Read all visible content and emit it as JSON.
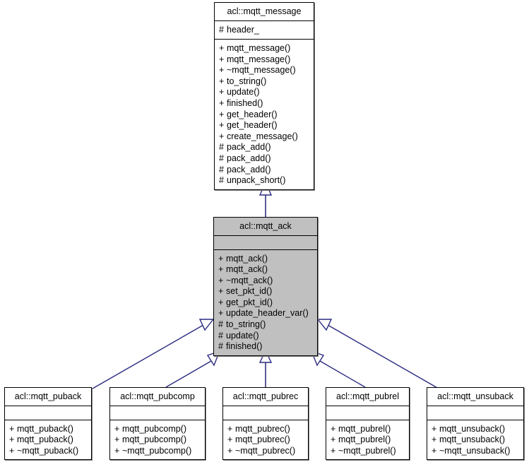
{
  "diagram": {
    "type": "uml-class-inheritance",
    "title": "acl::mqtt_ack inheritance diagram",
    "colors": {
      "box_border": "#000000",
      "box_fill": "#ffffff",
      "highlight_fill": "#c0c0c0",
      "edge_line": "#4a4a8c",
      "edge_line_dark": "#2a2a80",
      "shadow": "#808080",
      "text": "#000000",
      "background": "#ffffff"
    }
  },
  "classes": {
    "base": {
      "name": "acl::mqtt_message",
      "attributes": [
        {
          "visibility": "#",
          "label": "header_"
        }
      ],
      "operations": [
        {
          "visibility": "+",
          "label": "mqtt_message()"
        },
        {
          "visibility": "+",
          "label": "mqtt_message()"
        },
        {
          "visibility": "+",
          "label": "~mqtt_message()"
        },
        {
          "visibility": "+",
          "label": "to_string()"
        },
        {
          "visibility": "+",
          "label": "update()"
        },
        {
          "visibility": "+",
          "label": "finished()"
        },
        {
          "visibility": "+",
          "label": "get_header()"
        },
        {
          "visibility": "+",
          "label": "get_header()"
        },
        {
          "visibility": "+",
          "label": "create_message()"
        },
        {
          "visibility": "#",
          "label": "pack_add()"
        },
        {
          "visibility": "#",
          "label": "pack_add()"
        },
        {
          "visibility": "#",
          "label": "pack_add()"
        },
        {
          "visibility": "#",
          "label": "unpack_short()"
        }
      ]
    },
    "focus": {
      "name": "acl::mqtt_ack",
      "attributes": [],
      "operations": [
        {
          "visibility": "+",
          "label": "mqtt_ack()"
        },
        {
          "visibility": "+",
          "label": "mqtt_ack()"
        },
        {
          "visibility": "+",
          "label": "~mqtt_ack()"
        },
        {
          "visibility": "+",
          "label": "set_pkt_id()"
        },
        {
          "visibility": "+",
          "label": "get_pkt_id()"
        },
        {
          "visibility": "+",
          "label": "update_header_var()"
        },
        {
          "visibility": "#",
          "label": "to_string()"
        },
        {
          "visibility": "#",
          "label": "update()"
        },
        {
          "visibility": "#",
          "label": "finished()"
        }
      ]
    },
    "derived": [
      {
        "name": "acl::mqtt_puback",
        "attributes": [],
        "operations": [
          {
            "visibility": "+",
            "label": "mqtt_puback()"
          },
          {
            "visibility": "+",
            "label": "mqtt_puback()"
          },
          {
            "visibility": "+",
            "label": "~mqtt_puback()"
          }
        ]
      },
      {
        "name": "acl::mqtt_pubcomp",
        "attributes": [],
        "operations": [
          {
            "visibility": "+",
            "label": "mqtt_pubcomp()"
          },
          {
            "visibility": "+",
            "label": "mqtt_pubcomp()"
          },
          {
            "visibility": "+",
            "label": "~mqtt_pubcomp()"
          }
        ]
      },
      {
        "name": "acl::mqtt_pubrec",
        "attributes": [],
        "operations": [
          {
            "visibility": "+",
            "label": "mqtt_pubrec()"
          },
          {
            "visibility": "+",
            "label": "mqtt_pubrec()"
          },
          {
            "visibility": "+",
            "label": "~mqtt_pubrec()"
          }
        ]
      },
      {
        "name": "acl::mqtt_pubrel",
        "attributes": [],
        "operations": [
          {
            "visibility": "+",
            "label": "mqtt_pubrel()"
          },
          {
            "visibility": "+",
            "label": "mqtt_pubrel()"
          },
          {
            "visibility": "+",
            "label": "~mqtt_pubrel()"
          }
        ]
      },
      {
        "name": "acl::mqtt_unsuback",
        "attributes": [],
        "operations": [
          {
            "visibility": "+",
            "label": "mqtt_unsuback()"
          },
          {
            "visibility": "+",
            "label": "mqtt_unsuback()"
          },
          {
            "visibility": "+",
            "label": "~mqtt_unsuback()"
          }
        ]
      }
    ]
  },
  "edges": [
    {
      "from": "acl::mqtt_ack",
      "to": "acl::mqtt_message",
      "kind": "generalization"
    },
    {
      "from": "acl::mqtt_puback",
      "to": "acl::mqtt_ack",
      "kind": "generalization"
    },
    {
      "from": "acl::mqtt_pubcomp",
      "to": "acl::mqtt_ack",
      "kind": "generalization"
    },
    {
      "from": "acl::mqtt_pubrec",
      "to": "acl::mqtt_ack",
      "kind": "generalization"
    },
    {
      "from": "acl::mqtt_pubrel",
      "to": "acl::mqtt_ack",
      "kind": "generalization"
    },
    {
      "from": "acl::mqtt_unsuback",
      "to": "acl::mqtt_ack",
      "kind": "generalization"
    }
  ]
}
